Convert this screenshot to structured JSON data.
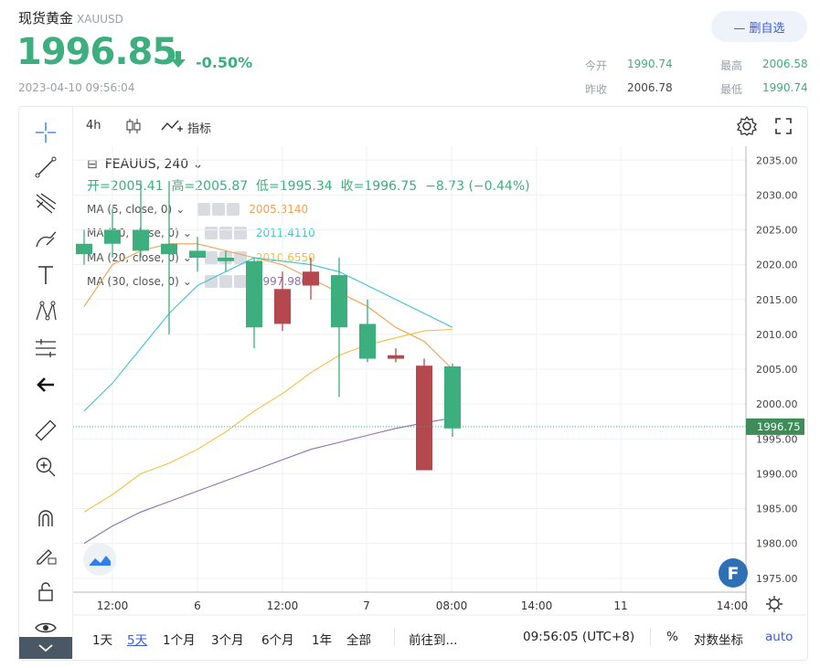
{
  "header": {
    "name": "现货黄金",
    "symbol": "XAUUSD",
    "price": "1996.85",
    "change_pct": "-0.50%",
    "timestamp": "2023-04-10 09:56:04",
    "watch_button": "— 删自选",
    "quote": {
      "open_label": "今开",
      "open_value": "1990.74",
      "high_label": "最高",
      "high_value": "2006.58",
      "prev_label": "昨收",
      "prev_value": "2006.78",
      "low_label": "最低",
      "low_value": "1990.74"
    },
    "colors": {
      "up": "#3dae7d",
      "down": "#b5474f",
      "accent": "#3b5bdb"
    }
  },
  "chart_top": {
    "interval": "4h",
    "indicators": "指标"
  },
  "legend": {
    "collapse_glyph": "⊟",
    "instrument": "FEAUUS, 240",
    "ohlc": "开=2005.41  高=2005.87  低=1995.34  收=1996.75  −8.73 (−0.44%)"
  },
  "ma": [
    {
      "label": "MA (5, close, 0)",
      "value": "2005.3140",
      "color": "#f0a050"
    },
    {
      "label": "MA (10, close, 0)",
      "value": "2011.4110",
      "color": "#40c4d4"
    },
    {
      "label": "MA (20, close, 0)",
      "value": "2010.6550",
      "color": "#f2c040"
    },
    {
      "label": "MA (30, close, 0)",
      "value": "1997.9800",
      "color": "#9070b0"
    }
  ],
  "bottom_bar": {
    "ranges": [
      "1天",
      "5天",
      "1个月",
      "3个月",
      "6个月",
      "1年",
      "全部"
    ],
    "active_range": "5天",
    "goto": "前往到...",
    "clock": "09:56:05 (UTC+8)",
    "percent": "%",
    "log": "对数坐标",
    "auto": "auto"
  },
  "chart_data": {
    "type": "candlestick",
    "ylim": [
      1973,
      2038
    ],
    "y_ticks": [
      "2035.00",
      "2030.00",
      "2025.00",
      "2020.00",
      "2015.00",
      "2010.00",
      "2005.00",
      "2000.00",
      "1995.00",
      "1990.00",
      "1985.00",
      "1980.00",
      "1975.00"
    ],
    "x_ticks": [
      "12:00",
      "6",
      "12:00",
      "7",
      "08:00",
      "14:00",
      "11",
      "14:00"
    ],
    "last_price_label": "1996.75",
    "last_price": 1996.75,
    "candles": [
      {
        "o": 2021.5,
        "h": 2025,
        "l": 2020,
        "c": 2023
      },
      {
        "o": 2023,
        "h": 2028,
        "l": 2021,
        "c": 2025
      },
      {
        "o": 2022,
        "h": 2032,
        "l": 2021,
        "c": 2025
      },
      {
        "o": 2021.5,
        "h": 2032,
        "l": 2010,
        "c": 2023
      },
      {
        "o": 2021,
        "h": 2024,
        "l": 2019,
        "c": 2022
      },
      {
        "o": 2020.5,
        "h": 2022,
        "l": 2019,
        "c": 2021
      },
      {
        "o": 2011,
        "h": 2021,
        "l": 2008,
        "c": 2020.5
      },
      {
        "o": 2016.5,
        "h": 2019,
        "l": 2010.5,
        "c": 2011.5
      },
      {
        "o": 2019,
        "h": 2021,
        "l": 2015,
        "c": 2017
      },
      {
        "o": 2011,
        "h": 2021,
        "l": 2001,
        "c": 2018.5
      },
      {
        "o": 2006.5,
        "h": 2015,
        "l": 2006,
        "c": 2011.5
      },
      {
        "o": 2007,
        "h": 2008,
        "l": 2006,
        "c": 2006.5
      },
      {
        "o": 2005.5,
        "h": 2006.5,
        "l": 1990.5,
        "c": 1990.5
      },
      {
        "o": 1996.5,
        "h": 2005.8,
        "l": 1995.3,
        "c": 2005.4
      }
    ],
    "ma_series": [
      {
        "name": "MA (5, close, 0)",
        "color": "#f0a050",
        "values": [
          2014,
          2020,
          2022,
          2023,
          2023,
          2022,
          2021,
          2020,
          2018,
          2016,
          2014,
          2011,
          2009,
          2005
        ]
      },
      {
        "name": "MA (10, close, 0)",
        "color": "#40c4d4",
        "values": [
          1999,
          2003,
          2008,
          2013,
          2017,
          2019,
          2021,
          2020.5,
          2020,
          2019,
          2017,
          2015,
          2013,
          2011
        ]
      },
      {
        "name": "MA (20, close, 0)",
        "color": "#f2c040",
        "values": [
          1984.5,
          1987,
          1990,
          1991.5,
          1993.5,
          1996,
          1999,
          2001.5,
          2004.5,
          2007,
          2008.5,
          2009.5,
          2010.5,
          2010.7
        ]
      },
      {
        "name": "MA (30, close, 0)",
        "color": "#9070b0",
        "values": [
          1980,
          1982.5,
          1984.5,
          1986,
          1987.5,
          1989,
          1990.5,
          1992,
          1993.5,
          1994.5,
          1995.5,
          1996.5,
          1997.3,
          1998
        ]
      }
    ]
  }
}
